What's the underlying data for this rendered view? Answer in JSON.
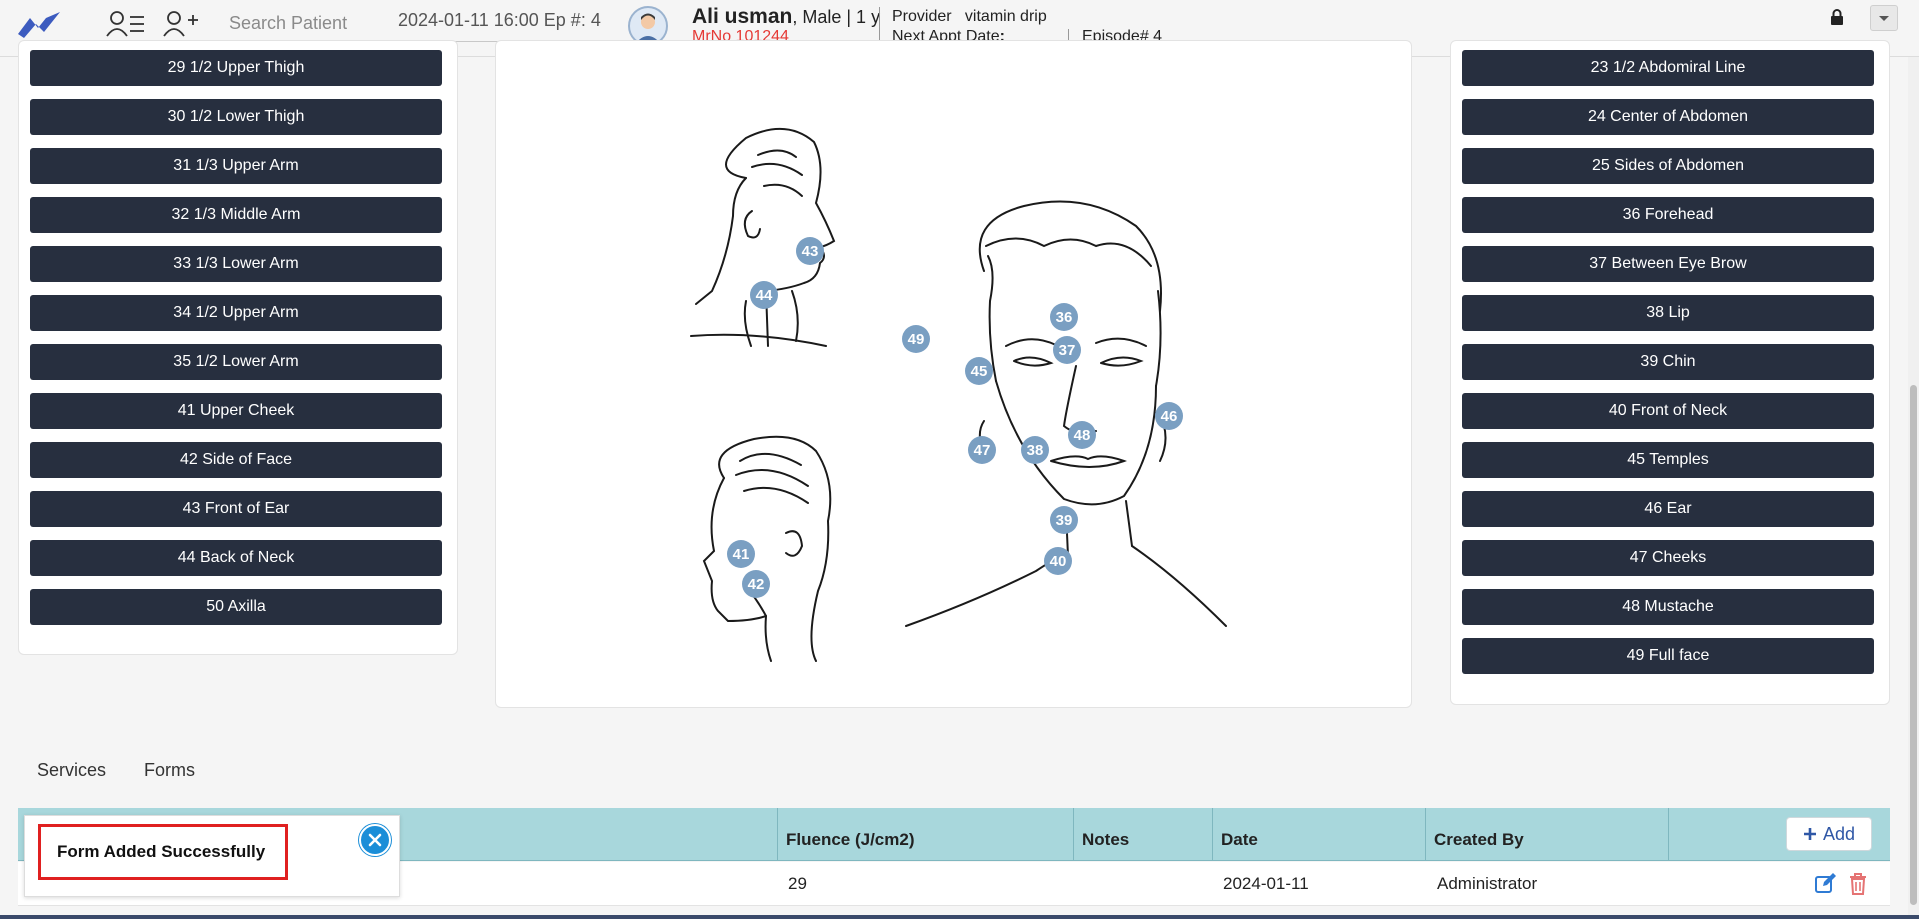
{
  "header": {
    "search_placeholder": "Search Patient",
    "visit_info": "2024-01-11 16:00 Ep #: 4",
    "patient_name": "Ali usman",
    "patient_info": ", Male | 1 y",
    "mrno": "MrNo 101244",
    "provider_label": "Provider",
    "provider_value": "vitamin drip",
    "next_appt_label": "Next Appt Date",
    "next_appt_colon": ":",
    "episode": "Episode# 4"
  },
  "left_zones": [
    "29 1/2 Upper Thigh",
    "30 1/2 Lower Thigh",
    "31 1/3 Upper Arm",
    "32 1/3 Middle Arm",
    "33 1/3 Lower Arm",
    "34 1/2 Upper Arm",
    "35 1/2 Lower Arm",
    "41 Upper Cheek",
    "42 Side of Face",
    "43 Front of Ear",
    "44 Back of Neck",
    "50 Axilla"
  ],
  "right_zones": [
    "23 1/2 Abdomiral Line",
    "24 Center of Abdomen",
    "25 Sides of Abdomen",
    "36 Forehead",
    "37 Between Eye Brow",
    "38 Lip",
    "39 Chin",
    "40 Front of Neck",
    "45 Temples",
    "46 Ear",
    "47 Cheeks",
    "48 Mustache",
    "49 Full face"
  ],
  "diagram_markers": [
    "43",
    "44",
    "49",
    "36",
    "37",
    "45",
    "46",
    "47",
    "38",
    "48",
    "39",
    "40",
    "41",
    "42"
  ],
  "tabs": [
    "Services",
    "Forms"
  ],
  "table": {
    "headers": [
      "Fluence (J/cm2)",
      "Notes",
      "Date",
      "Created By"
    ],
    "add_label": "Add",
    "rows": [
      {
        "fluence": "29",
        "notes": "",
        "date": "2024-01-11",
        "created_by": "Administrator"
      }
    ]
  },
  "toast": {
    "message": "Form Added Successfully"
  },
  "colors": {
    "zone_button": "#272f3f",
    "marker": "#7a9fc2",
    "table_header": "#a8d7dc",
    "mrno": "#e53935",
    "add_icon": "#2f57a6",
    "delete_icon": "#e57373"
  }
}
